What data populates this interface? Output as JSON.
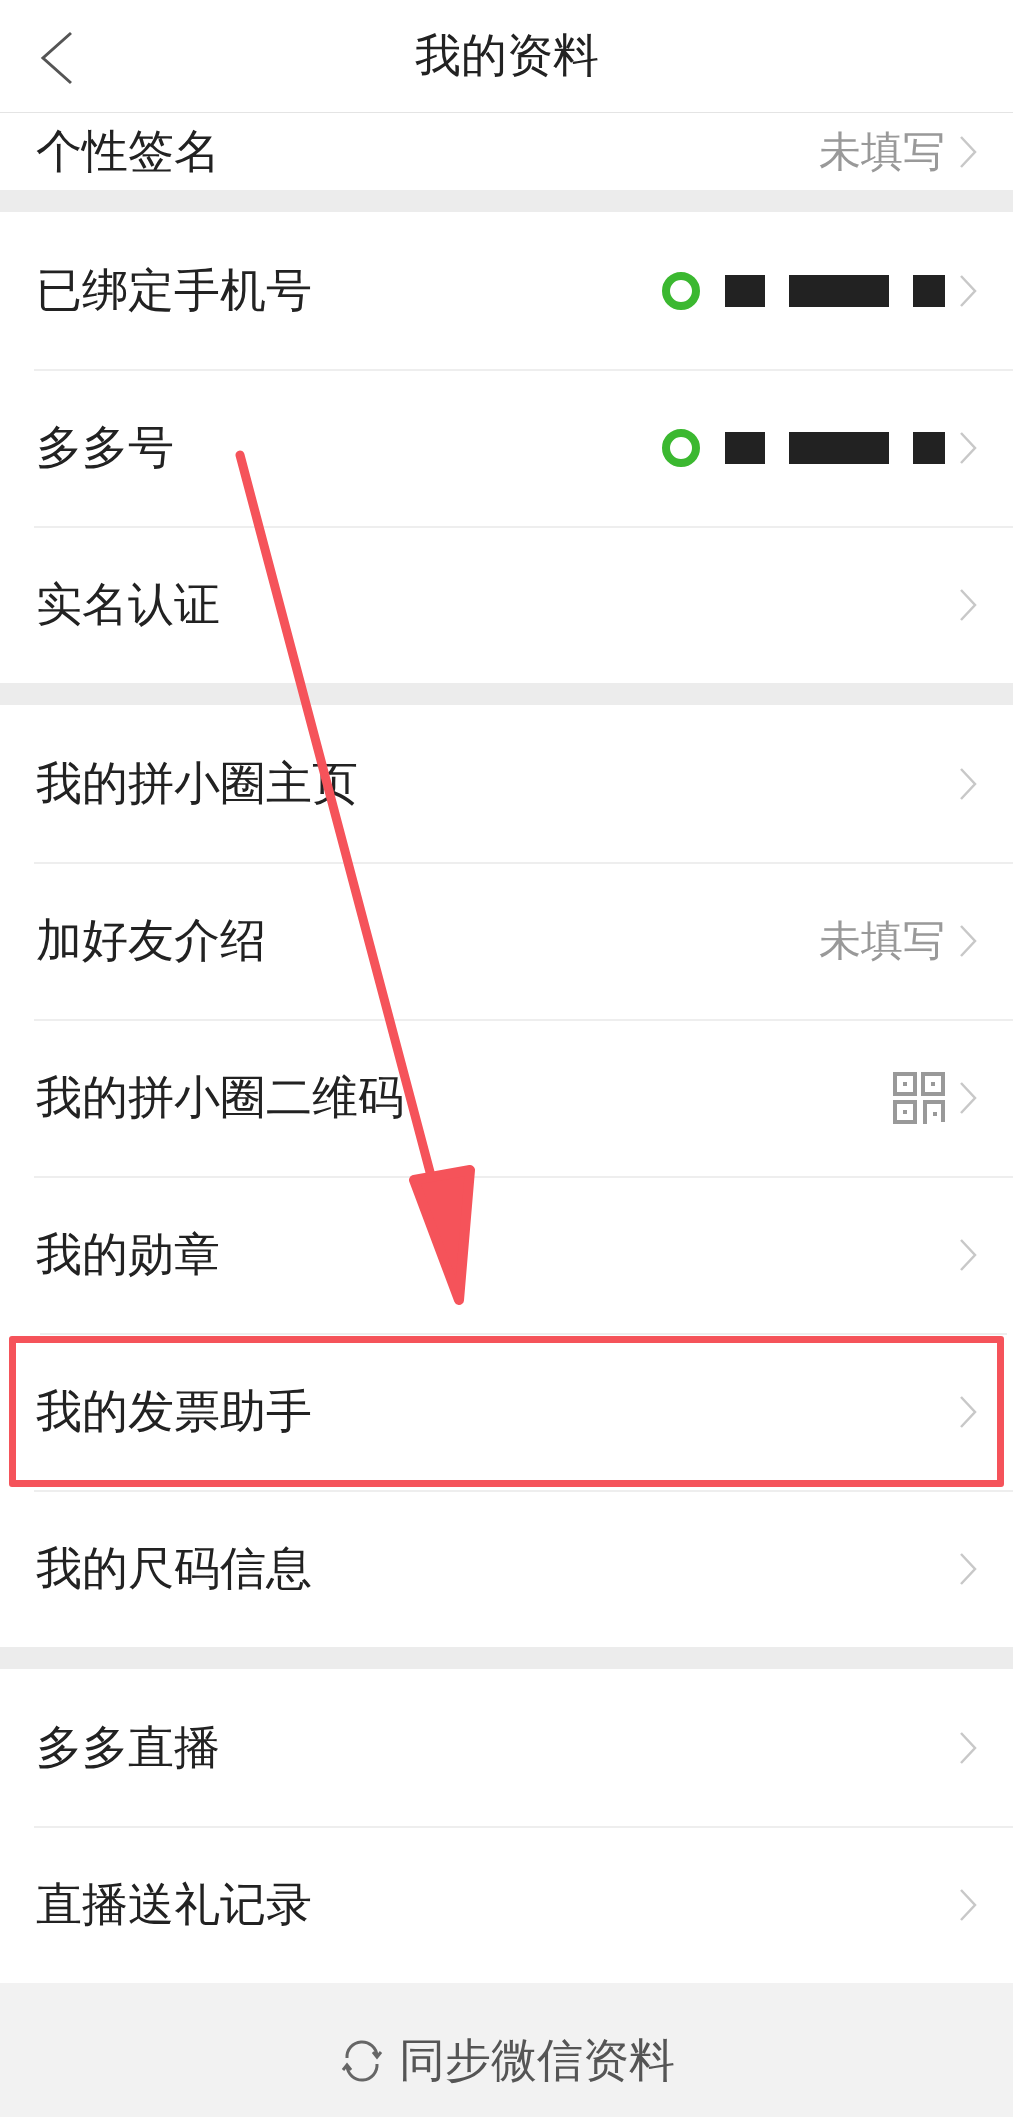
{
  "header": {
    "title": "我的资料"
  },
  "scrolled_row": {
    "label": "个性签名",
    "value": "未填写"
  },
  "groups": [
    {
      "items": [
        {
          "label": "已绑定手机号",
          "kind": "redacted",
          "highlighted": false
        },
        {
          "label": "多多号",
          "kind": "redacted",
          "highlighted": false
        },
        {
          "label": "实名认证",
          "kind": "plain",
          "highlighted": false
        }
      ]
    },
    {
      "items": [
        {
          "label": "我的拼小圈主页",
          "kind": "plain",
          "highlighted": false
        },
        {
          "label": "加好友介绍",
          "value": "未填写",
          "kind": "text",
          "highlighted": false
        },
        {
          "label": "我的拼小圈二维码",
          "kind": "qr",
          "highlighted": false
        },
        {
          "label": "我的勋章",
          "kind": "plain",
          "highlighted": false
        },
        {
          "label": "我的发票助手",
          "kind": "plain",
          "highlighted": true
        },
        {
          "label": "我的尺码信息",
          "kind": "plain",
          "highlighted": false
        }
      ]
    },
    {
      "items": [
        {
          "label": "多多直播",
          "kind": "plain",
          "highlighted": false
        },
        {
          "label": "直播送礼记录",
          "kind": "plain",
          "highlighted": false
        }
      ]
    }
  ],
  "footer": {
    "label": "同步微信资料"
  },
  "annotation": {
    "kind": "arrow"
  }
}
